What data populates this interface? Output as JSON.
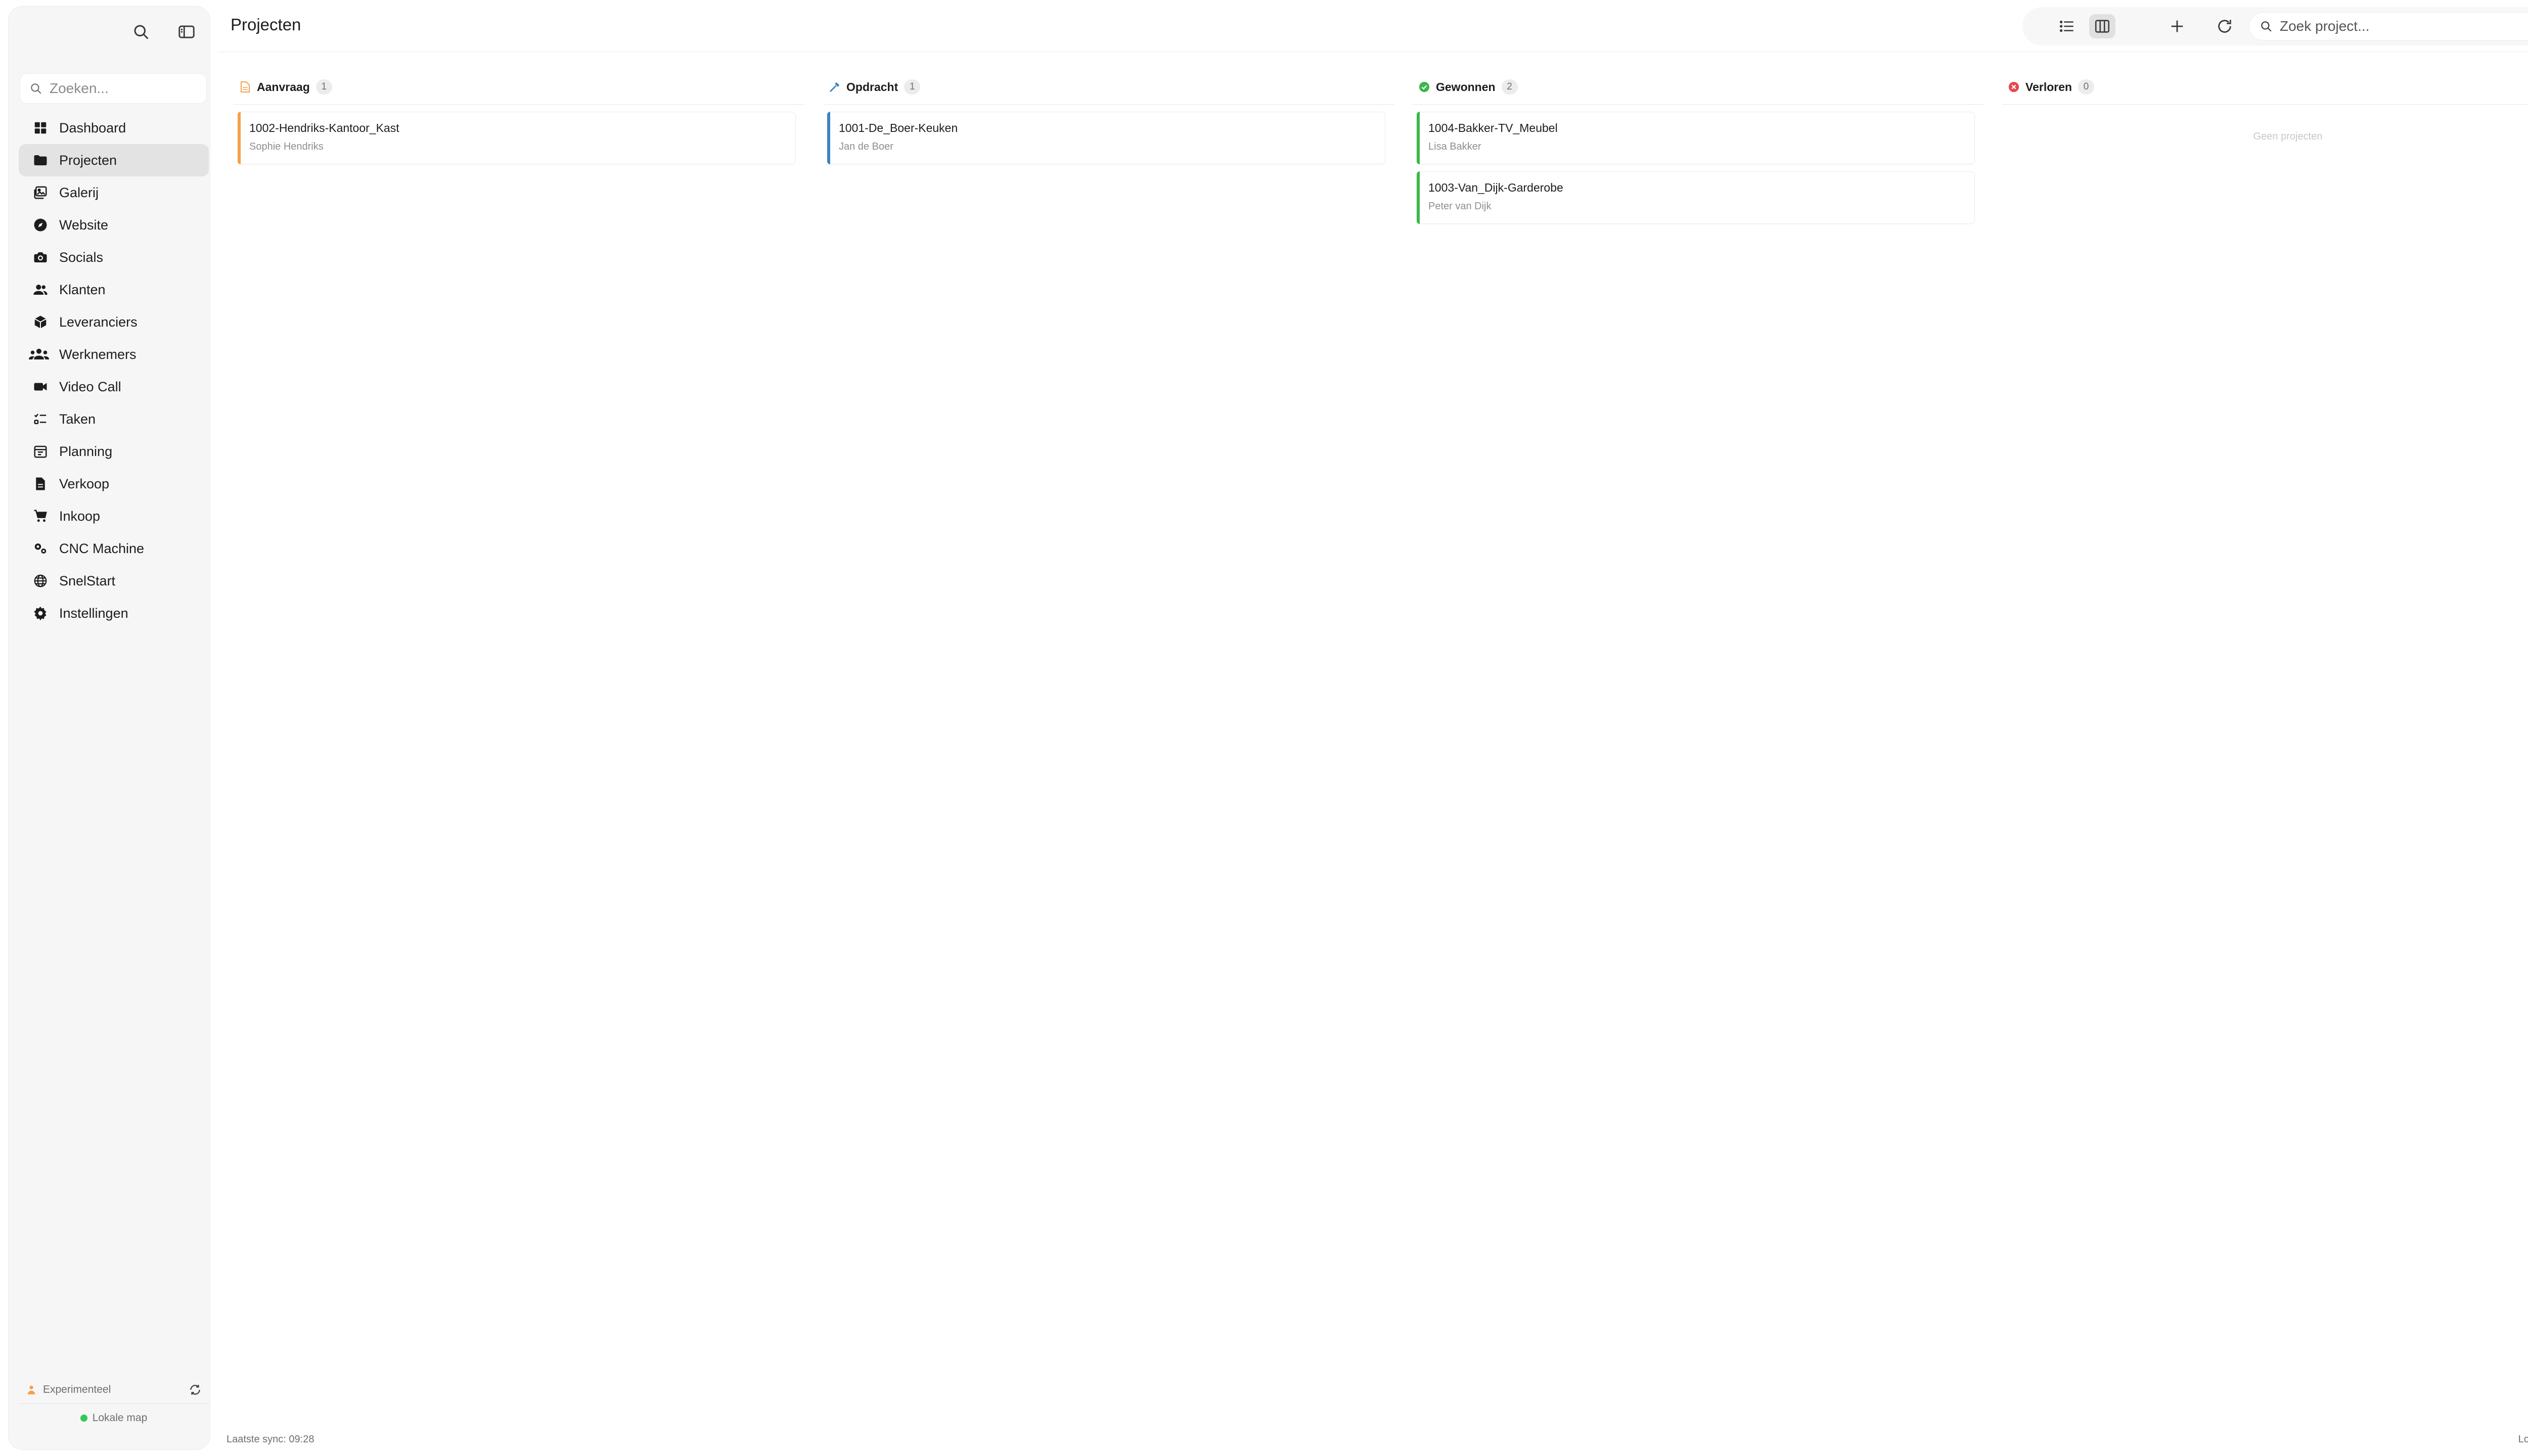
{
  "header": {
    "title": "Projecten"
  },
  "toolbar": {
    "list_view_icon": "list-icon",
    "board_view_icon": "columns-icon",
    "add_icon": "plus-icon",
    "refresh_icon": "refresh-icon",
    "search_placeholder": "Zoek project..."
  },
  "sidebar": {
    "search_placeholder": "Zoeken...",
    "items": [
      {
        "label": "Dashboard",
        "icon": "dashboard-icon"
      },
      {
        "label": "Projecten",
        "icon": "folder-icon",
        "active": true
      },
      {
        "label": "Galerij",
        "icon": "gallery-icon"
      },
      {
        "label": "Website",
        "icon": "compass-icon"
      },
      {
        "label": "Socials",
        "icon": "camera-icon"
      },
      {
        "label": "Klanten",
        "icon": "users-icon"
      },
      {
        "label": "Leveranciers",
        "icon": "box-icon"
      },
      {
        "label": "Werknemers",
        "icon": "team-icon"
      },
      {
        "label": "Video Call",
        "icon": "video-icon"
      },
      {
        "label": "Taken",
        "icon": "checklist-icon"
      },
      {
        "label": "Planning",
        "icon": "calendar-icon"
      },
      {
        "label": "Verkoop",
        "icon": "document-icon"
      },
      {
        "label": "Inkoop",
        "icon": "cart-icon"
      },
      {
        "label": "CNC Machine",
        "icon": "gears-icon"
      },
      {
        "label": "SnelStart",
        "icon": "globe-icon"
      },
      {
        "label": "Instellingen",
        "icon": "settings-icon"
      }
    ],
    "footer": {
      "experimental": "Experimenteel",
      "local_folder": "Lokale map"
    }
  },
  "board": {
    "columns": [
      {
        "name": "Aanvraag",
        "count": "1",
        "color": "#f5a04a",
        "icon": "document-icon",
        "cards": [
          {
            "title": "1002-Hendriks-Kantoor_Kast",
            "client": "Sophie Hendriks"
          }
        ]
      },
      {
        "name": "Opdracht",
        "count": "1",
        "color": "#3b82c4",
        "icon": "hammer-icon",
        "cards": [
          {
            "title": "1001-De_Boer-Keuken",
            "client": "Jan de Boer"
          }
        ]
      },
      {
        "name": "Gewonnen",
        "count": "2",
        "color": "#3cb64a",
        "icon": "check-circle-icon",
        "cards": [
          {
            "title": "1004-Bakker-TV_Meubel",
            "client": "Lisa Bakker"
          },
          {
            "title": "1003-Van_Dijk-Garderobe",
            "client": "Peter van Dijk"
          }
        ]
      },
      {
        "name": "Verloren",
        "count": "0",
        "color": "#e5484d",
        "icon": "x-circle-icon",
        "cards": [],
        "empty_text": "Geen projecten"
      }
    ]
  },
  "footer": {
    "last_sync": "Laatste sync: 09:28",
    "local_folder": "Lokale map"
  }
}
